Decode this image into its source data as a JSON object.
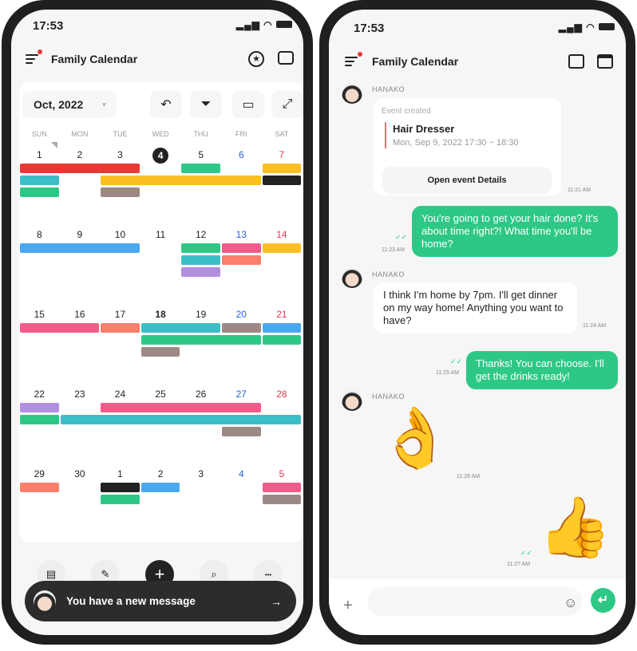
{
  "colors": {
    "accent": "#2ec886",
    "saturday": "#e53950",
    "friday": "#2b5fd9",
    "today_bg": "#222222"
  },
  "left": {
    "status": {
      "time": "17:53",
      "icons": [
        "signal-icon",
        "wifi-icon",
        "battery-icon"
      ]
    },
    "header": {
      "title": "Family Calendar",
      "icons": [
        "menu-icon",
        "star-circle-icon",
        "chat-list-icon"
      ]
    },
    "toolbar": {
      "month": "Oct, 2022",
      "dropdown": "▾",
      "icons": [
        "undo-icon",
        "filter-icon",
        "calendar-icon",
        "expand-icon"
      ],
      "undo": "↶",
      "filter": "⏷",
      "calendar": "▭",
      "expand": "⤢"
    },
    "weekdays": [
      "SUN",
      "MON",
      "TUE",
      "WED",
      "THU",
      "FRI",
      "SAT"
    ],
    "weeks": [
      [
        1,
        2,
        3,
        4,
        5,
        6,
        7
      ],
      [
        8,
        9,
        10,
        11,
        12,
        13,
        14
      ],
      [
        15,
        16,
        17,
        18,
        19,
        20,
        21
      ],
      [
        22,
        23,
        24,
        25,
        26,
        27,
        28
      ],
      [
        29,
        30,
        1,
        2,
        3,
        4,
        5
      ]
    ],
    "today": "4",
    "bold_day": "18",
    "events": [
      {
        "week": 0,
        "start": 0,
        "end": 2,
        "lane": 0,
        "color": "#e53935"
      },
      {
        "week": 0,
        "start": 4,
        "end": 4,
        "lane": 0,
        "color": "#2ec886"
      },
      {
        "week": 0,
        "start": 6,
        "end": 6,
        "lane": 0,
        "color": "#fbbf24"
      },
      {
        "week": 0,
        "start": 0,
        "end": 0,
        "lane": 1,
        "color": "#3bbfc7"
      },
      {
        "week": 0,
        "start": 2,
        "end": 5,
        "lane": 1,
        "color": "#fbbf24"
      },
      {
        "week": 0,
        "start": 6,
        "end": 6,
        "lane": 1,
        "color": "#222222"
      },
      {
        "week": 0,
        "start": 0,
        "end": 0,
        "lane": 2,
        "color": "#2ec886"
      },
      {
        "week": 0,
        "start": 2,
        "end": 2,
        "lane": 2,
        "color": "#9c8985"
      },
      {
        "week": 1,
        "start": 0,
        "end": 2,
        "lane": 0,
        "color": "#4aa8f0"
      },
      {
        "week": 1,
        "start": 4,
        "end": 4,
        "lane": 0,
        "color": "#2ec886"
      },
      {
        "week": 1,
        "start": 5,
        "end": 5,
        "lane": 0,
        "color": "#f25c8a"
      },
      {
        "week": 1,
        "start": 6,
        "end": 6,
        "lane": 0,
        "color": "#fbbf24"
      },
      {
        "week": 1,
        "start": 4,
        "end": 4,
        "lane": 1,
        "color": "#3bbfc7"
      },
      {
        "week": 1,
        "start": 5,
        "end": 5,
        "lane": 1,
        "color": "#fb7f6b"
      },
      {
        "week": 1,
        "start": 4,
        "end": 4,
        "lane": 2,
        "color": "#b48ee0"
      },
      {
        "week": 2,
        "start": 0,
        "end": 1,
        "lane": 0,
        "color": "#f25c8a"
      },
      {
        "week": 2,
        "start": 2,
        "end": 2,
        "lane": 0,
        "color": "#fb7f6b"
      },
      {
        "week": 2,
        "start": 3,
        "end": 4,
        "lane": 0,
        "color": "#3bbfc7"
      },
      {
        "week": 2,
        "start": 5,
        "end": 5,
        "lane": 0,
        "color": "#9c8985"
      },
      {
        "week": 2,
        "start": 6,
        "end": 6,
        "lane": 0,
        "color": "#4aa8f0"
      },
      {
        "week": 2,
        "start": 3,
        "end": 5,
        "lane": 1,
        "color": "#2ec886"
      },
      {
        "week": 2,
        "start": 6,
        "end": 6,
        "lane": 1,
        "color": "#2ec886"
      },
      {
        "week": 2,
        "start": 3,
        "end": 3,
        "lane": 2,
        "color": "#9c8985"
      },
      {
        "week": 3,
        "start": 0,
        "end": 0,
        "lane": 0,
        "color": "#b48ee0"
      },
      {
        "week": 3,
        "start": 2,
        "end": 5,
        "lane": 0,
        "color": "#f25c8a"
      },
      {
        "week": 3,
        "start": 0,
        "end": 0,
        "lane": 1,
        "color": "#2ec886"
      },
      {
        "week": 3,
        "start": 1,
        "end": 6,
        "lane": 1,
        "color": "#3bbfc7"
      },
      {
        "week": 3,
        "start": 5,
        "end": 5,
        "lane": 2,
        "color": "#9c8985"
      },
      {
        "week": 4,
        "start": 0,
        "end": 0,
        "lane": 0,
        "color": "#fb7f6b"
      },
      {
        "week": 4,
        "start": 2,
        "end": 2,
        "lane": 0,
        "color": "#222222"
      },
      {
        "week": 4,
        "start": 3,
        "end": 3,
        "lane": 0,
        "color": "#4aa8f0"
      },
      {
        "week": 4,
        "start": 6,
        "end": 6,
        "lane": 0,
        "color": "#f25c8a"
      },
      {
        "week": 4,
        "start": 2,
        "end": 2,
        "lane": 1,
        "color": "#2ec886"
      },
      {
        "week": 4,
        "start": 6,
        "end": 6,
        "lane": 1,
        "color": "#9c8985"
      }
    ],
    "bottom_nav": {
      "icons": [
        "memo-icon",
        "edit-icon",
        "add-icon",
        "search-icon",
        "more-icon"
      ],
      "memo": "▤",
      "edit": "✎",
      "add": "+",
      "search": "⌕",
      "more": "•••"
    },
    "toast": {
      "text": "You have a new message",
      "arrow": "→"
    }
  },
  "right": {
    "status": {
      "time": "17:53"
    },
    "header": {
      "title": "Family Calendar",
      "icons": [
        "menu-icon",
        "memo-pen-icon",
        "calendar-icon"
      ]
    },
    "messages": [
      {
        "sender": "HANAKO",
        "type": "event",
        "label": "Event created",
        "event_title": "Hair Dresser",
        "event_time": "Mon, Sep 9, 2022 17:30 ~ 18:30",
        "button": "Open event Details",
        "time": "11:21 AM"
      },
      {
        "type": "out",
        "text": "You're going to get your hair done? It's about time right?! What time you'll be home?",
        "time": "11:23 AM",
        "read": "✓✓"
      },
      {
        "sender": "HANAKO",
        "type": "in",
        "text": "I think I'm home by 7pm. I'll get dinner on my way home! Anything you want to have?",
        "time": "11:24 AM"
      },
      {
        "type": "out",
        "text": "Thanks! You can choose. I'll get the drinks ready!",
        "time": "11:25 AM",
        "read": "✓✓"
      },
      {
        "sender": "HANAKO",
        "type": "sticker",
        "emoji": "👌",
        "time": "11:26 AM"
      },
      {
        "type": "sticker-out",
        "emoji": "👍",
        "time": "11:27 AM",
        "read": "✓✓"
      }
    ],
    "composer": {
      "add": "+",
      "placeholder": "",
      "emoji": "☺",
      "send": "↵"
    }
  }
}
